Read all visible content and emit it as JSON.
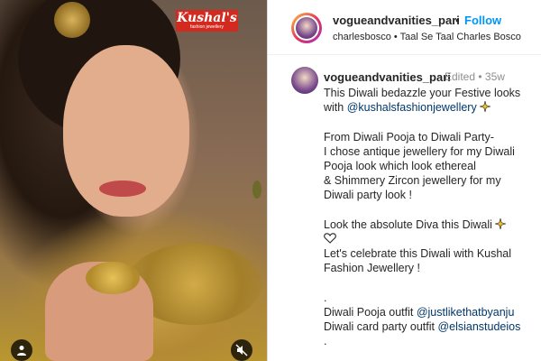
{
  "media": {
    "brand": {
      "name": "Kushal's",
      "tagline": "fashion jewellery"
    },
    "user_icon": "person-icon",
    "mute_icon": "speaker-muted-icon"
  },
  "header": {
    "username": "vogueandvanities_pari",
    "separator": "•",
    "follow_label": "Follow",
    "subline": "charlesbosco • Taal Se Taal Charles Bosco"
  },
  "caption": {
    "username": "vogueandvanities_pari",
    "meta": "Edited • 35w",
    "lines": {
      "l1": "This Diwali bedazzle your Festive looks",
      "l2_text": "with ",
      "l2_mention": "@kushalsfashionjewellery",
      "l4": "From Diwali Pooja to Diwali Party-",
      "l5": "I chose antique jewellery for my Diwali",
      "l6": "Pooja look which look ethereal",
      "l7": "& Shimmery Zircon jewellery for my",
      "l8": "Diwali party look !",
      "l10": "Look the absolute Diva this Diwali",
      "l12": "Let's celebrate this Diwali with Kushal",
      "l13": "Fashion Jewellery !",
      "l15": ".",
      "l16_text": "Diwali Pooja outfit ",
      "l16_mention": "@justlikethatbyanju",
      "l17_text": "Diwali card party outfit ",
      "l17_mention": "@elsianstudeios",
      "l18": "."
    }
  },
  "colors": {
    "follow": "#0095f6",
    "mention": "#00376b",
    "brand_bg": "#d22a1f",
    "meta": "#8e8e8e"
  }
}
